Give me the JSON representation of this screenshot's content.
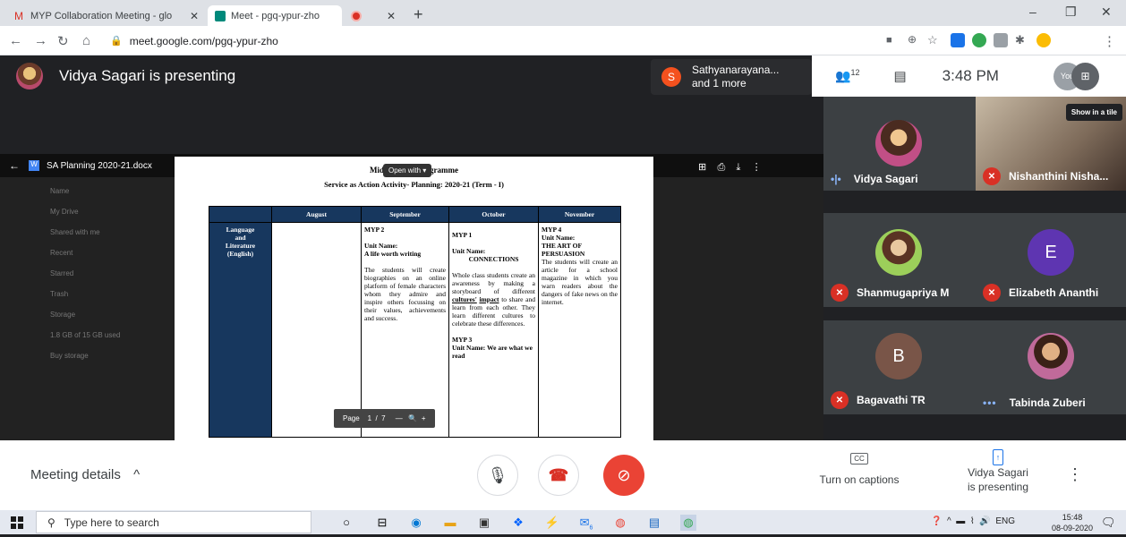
{
  "browser": {
    "tabs": [
      {
        "title": "MYP Collaboration Meeting - glo",
        "active": false
      },
      {
        "title": "Meet - pgq-ypur-zho",
        "active": true
      },
      {
        "title": "",
        "active": false
      }
    ],
    "url": "meet.google.com/pgq-ypur-zho",
    "window_controls": [
      "–",
      "❐",
      "✕"
    ]
  },
  "meet": {
    "presenting_banner": "Vidya Sagari is presenting",
    "other_presenter": {
      "initial": "S",
      "line1": "Sathyanarayana...",
      "line2": "and 1 more"
    },
    "participant_count": "12",
    "time": "3:48 PM",
    "you_label": "You",
    "show_in_tile": "Show in a tile",
    "participants": [
      {
        "name": "Vidya Sagari",
        "state": "speaking"
      },
      {
        "name": "Nishanthini Nisha...",
        "state": "muted"
      },
      {
        "name": "Shanmugapriya M",
        "state": "muted"
      },
      {
        "name": "Elizabeth Ananthi",
        "state": "muted",
        "initial": "E"
      },
      {
        "name": "Bagavathi TR",
        "state": "muted",
        "initial": "B"
      },
      {
        "name": "Tabinda Zuberi",
        "state": "active"
      }
    ],
    "bottom": {
      "meeting_details": "Meeting details",
      "captions": "Turn on captions",
      "captions_icon": "CC",
      "presenting_line1": "Vidya Sagari",
      "presenting_line2": "is presenting"
    }
  },
  "shared_screen": {
    "file_name": "SA Planning 2020-21.docx",
    "open_with": "Open with",
    "doc_title": "Middle Years Programme",
    "doc_subtitle": "Service as Action Activity- Planning: 2020-21 (Term - I)",
    "drive_sidebar": [
      "Name",
      "My Drive",
      "Shared with me",
      "Recent",
      "Starred",
      "Trash",
      "Storage",
      "1.8 GB of 15 GB used",
      "Buy storage"
    ],
    "table": {
      "headers": [
        "",
        "August",
        "September",
        "October",
        "November"
      ],
      "subject_lines": [
        "Language",
        "and",
        "Literature",
        "(English)"
      ],
      "september": {
        "myp": "MYP 2",
        "unit_label": "Unit Name:",
        "unit_name": "A life worth writing",
        "body": "The students will create biographies on an online platform of female characters whom they admire and inspire others focussing on their values, achievements and success."
      },
      "october": {
        "myp": "MYP 1",
        "unit_label": "Unit Name:",
        "unit_name": "CONNECTIONS",
        "body_a": "Whole class students create an awareness by making a storyboard of different",
        "emph1": "cultures'",
        "emph2": "impact",
        "body_b": "to share and learn from each other. They learn different cultures to celebrate these differences.",
        "myp3": "MYP 3",
        "unit3": "Unit Name: We are what we read"
      },
      "november": {
        "myp": "MYP 4",
        "unit_label": "Unit Name:",
        "unit_name": "THE ART OF PERSUASION",
        "body": "The students will create an article for a school magazine in which you warn readers about the dangers of fake news on the internet."
      }
    },
    "pager": {
      "label": "Page",
      "current": "1",
      "sep": "/",
      "total": "7"
    }
  },
  "taskbar": {
    "search_placeholder": "Type here to search",
    "lang": "ENG",
    "time": "15:48",
    "date": "08-09-2020",
    "badge": "6"
  },
  "colors": {
    "meet_bg": "#202124",
    "end_call": "#ea4335",
    "table_header": "#17375e",
    "accent_blue": "#1a73e8"
  }
}
